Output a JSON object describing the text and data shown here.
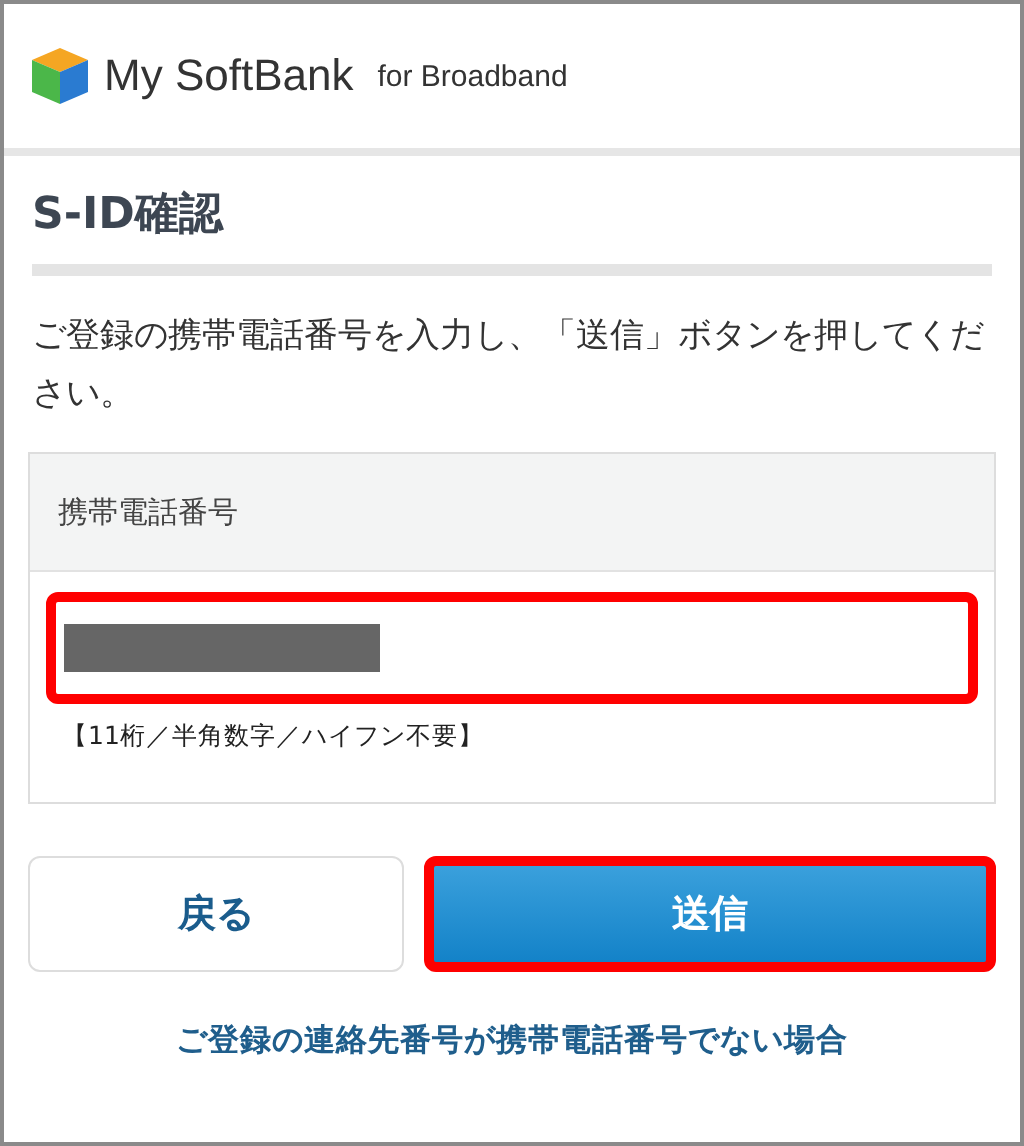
{
  "header": {
    "logo_text": "My SoftBank",
    "logo_suffix": "for Broadband"
  },
  "page_title": "S-ID確認",
  "instruction": "ご登録の携帯電話番号を入力し、「送信」ボタンを押してください。",
  "form": {
    "label": "携帯電話番号",
    "field": {
      "redacted": true,
      "highlighted": true
    },
    "hint": "【11桁／半角数字／ハイフン不要】"
  },
  "buttons": [
    {
      "kind": "secondary",
      "label": "戻る",
      "highlighted": false
    },
    {
      "kind": "primary",
      "label": "送信",
      "highlighted": true
    }
  ],
  "link": "ご登録の連絡先番号が携帯電話番号でない場合"
}
